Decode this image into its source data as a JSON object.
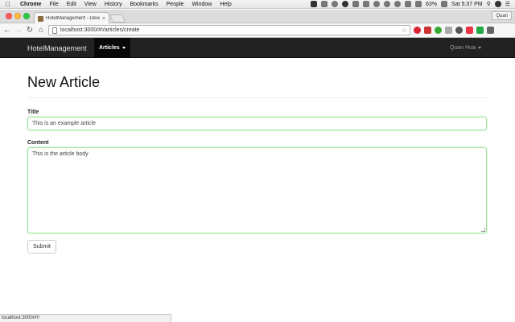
{
  "menubar": {
    "app_name": "Chrome",
    "items": [
      "File",
      "Edit",
      "View",
      "History",
      "Bookmarks",
      "People",
      "Window",
      "Help"
    ],
    "battery": "63%",
    "clock": "Sat 5:37 PM"
  },
  "browser": {
    "tab_title": "HotelManagement - Devel",
    "profile_name": "Quan",
    "url": "localhost:3000/#!/articles/create",
    "status_url": "localhost:3000/#!/"
  },
  "navbar": {
    "brand": "HotelManagement",
    "articles_label": "Articles",
    "user_label": "Quan Hua"
  },
  "form": {
    "page_title": "New Article",
    "title_label": "Title",
    "title_value": "This is an example article",
    "content_label": "Content",
    "content_value": "This is the article body",
    "submit_label": "Submit"
  },
  "colors": {
    "navbar_bg": "#222222",
    "focus_border": "#9de39b"
  }
}
